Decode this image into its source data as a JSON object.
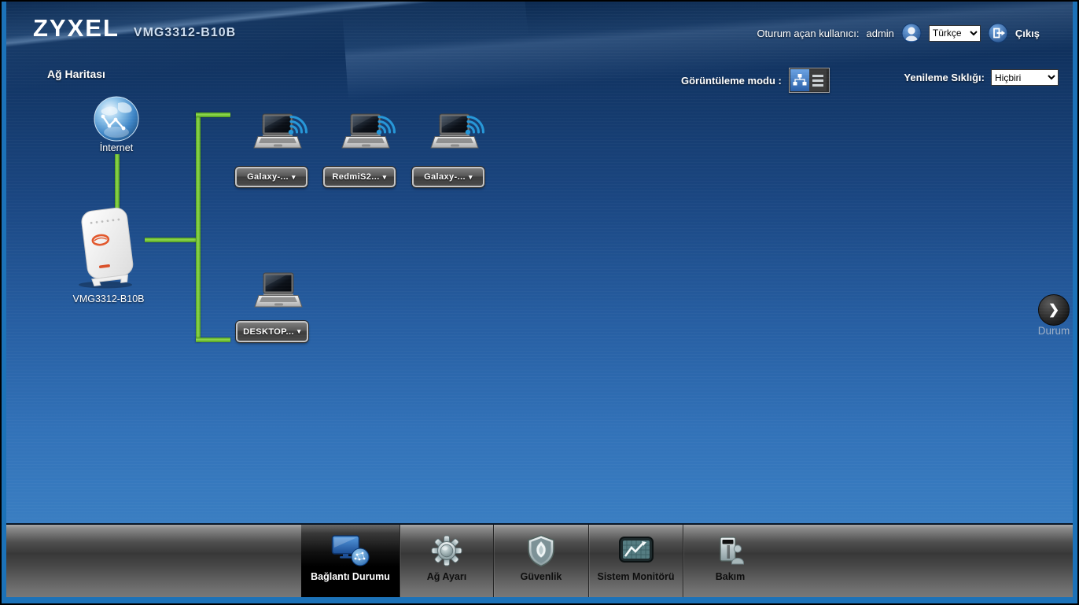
{
  "window": {
    "brand": "ZYXEL",
    "model": "VMG3312-B10B"
  },
  "header": {
    "session_label": "Oturum açan kullanıcı:",
    "session_user": "admin",
    "language_selected": "Türkçe",
    "logout_label": "Çıkış"
  },
  "toolbar": {
    "page_title": "Ağ Haritası",
    "view_mode_label": "Görüntüleme modu :",
    "refresh_label": "Yenileme Sıklığı:",
    "refresh_selected": "Hiçbiri"
  },
  "map": {
    "internet_label": "İnternet",
    "router_label": "VMG3312-B10B",
    "devices": [
      {
        "label": "Galaxy-...",
        "connection": "wireless"
      },
      {
        "label": "RedmiS2...",
        "connection": "wireless"
      },
      {
        "label": "Galaxy-...",
        "connection": "wireless"
      },
      {
        "label": "DESKTOP...",
        "connection": "wired"
      }
    ],
    "status_label": "Durum"
  },
  "nav": {
    "items": [
      {
        "label": "Bağlantı Durumu",
        "active": true
      },
      {
        "label": "Ağ Ayarı",
        "active": false
      },
      {
        "label": "Güvenlik",
        "active": false
      },
      {
        "label": "Sistem Monitörü",
        "active": false
      },
      {
        "label": "Bakım",
        "active": false
      }
    ]
  },
  "icons": {
    "caret": "▾",
    "chevron_right": "❯"
  },
  "colors": {
    "frame_blue": "#1c72b8",
    "bg_top": "#0b2950",
    "bg_bottom": "#3a7ec2",
    "link_green": "#6cc12c",
    "wifi_blue": "#2697d8",
    "nav_active_bg": "#000000"
  }
}
